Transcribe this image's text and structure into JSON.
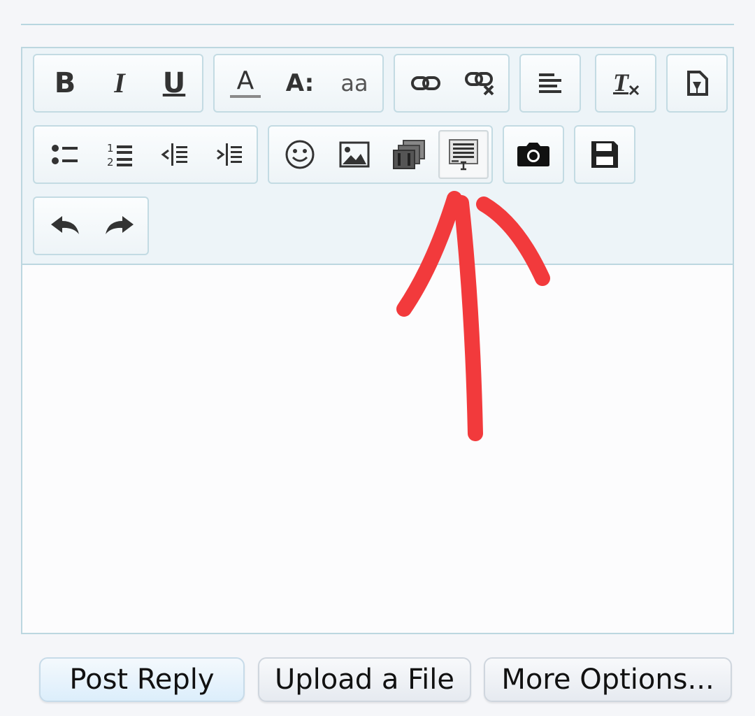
{
  "toolbar": {
    "row1": [
      {
        "name": "bold",
        "icon": "bold-icon",
        "glyph": "B"
      },
      {
        "name": "italic",
        "icon": "italic-icon",
        "glyph": "I"
      },
      {
        "name": "underline",
        "icon": "underline-icon",
        "glyph": "U"
      },
      {
        "name": "text-color",
        "icon": "text-color-icon",
        "glyph": "A"
      },
      {
        "name": "font-size",
        "icon": "font-size-icon",
        "glyph": "A:"
      },
      {
        "name": "font-family",
        "icon": "font-family-icon",
        "glyph": "aa"
      },
      {
        "name": "link",
        "icon": "link-icon"
      },
      {
        "name": "unlink",
        "icon": "unlink-icon"
      },
      {
        "name": "align",
        "icon": "align-left-icon"
      },
      {
        "name": "remove-format",
        "icon": "remove-format-icon",
        "glyph": "T"
      },
      {
        "name": "spoiler",
        "icon": "spoiler-icon"
      }
    ],
    "row2": [
      {
        "name": "bullet-list",
        "icon": "bullet-list-icon"
      },
      {
        "name": "numbered-list",
        "icon": "numbered-list-icon"
      },
      {
        "name": "outdent",
        "icon": "outdent-icon"
      },
      {
        "name": "indent",
        "icon": "indent-icon"
      },
      {
        "name": "smilies",
        "icon": "smiley-icon"
      },
      {
        "name": "image",
        "icon": "image-icon"
      },
      {
        "name": "media",
        "icon": "media-icon"
      },
      {
        "name": "insert-quote",
        "icon": "insert-quote-icon",
        "active": true
      },
      {
        "name": "camera",
        "icon": "camera-icon"
      },
      {
        "name": "save-draft",
        "icon": "save-icon"
      }
    ],
    "row3": [
      {
        "name": "undo",
        "icon": "undo-icon"
      },
      {
        "name": "redo",
        "icon": "redo-icon"
      }
    ]
  },
  "editor": {
    "content": ""
  },
  "buttons": {
    "post_reply": "Post Reply",
    "upload_file": "Upload a File",
    "more_options": "More Options..."
  },
  "annotation": {
    "type": "hand-drawn arrow",
    "color": "#f23a3c",
    "points_to": "insert-quote-button"
  },
  "colors": {
    "border": "#bcd7e0",
    "toolbar_bg": "#edf4f8",
    "icon": "#333333",
    "arrow": "#f23a3c"
  }
}
